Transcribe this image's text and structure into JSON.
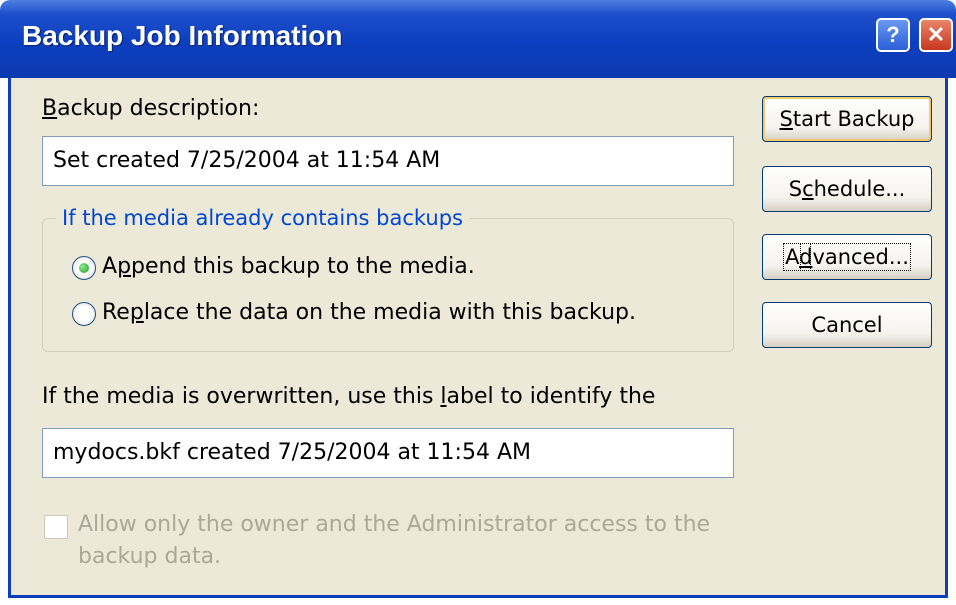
{
  "window": {
    "title": "Backup Job Information",
    "help_glyph": "?",
    "close_glyph": "✕"
  },
  "backup_description": {
    "label_pre": "",
    "label_key": "B",
    "label_post": "ackup description:",
    "value": "Set created 7/25/2004 at 11:54 AM"
  },
  "media_group": {
    "title": "If the media already contains backups",
    "append": {
      "pre": "A",
      "key": "p",
      "post": "pend this backup to the media.",
      "selected": true
    },
    "replace": {
      "pre": "Re",
      "key": "p",
      "post": "lace the data on the media with this backup.",
      "selected": false
    }
  },
  "label_section": {
    "pre": "If the media is overwritten, use this ",
    "key": "l",
    "post": "abel to identify the",
    "value": "mydocs.bkf created 7/25/2004 at 11:54 AM"
  },
  "owner_access": {
    "line1": "Allow only the owner and the Administrator access to the",
    "line2": "backup data.",
    "checked": false,
    "enabled": false
  },
  "buttons": {
    "start": {
      "key": "S",
      "post": "tart Backup"
    },
    "schedule": {
      "pre": "S",
      "key": "c",
      "post": "hedule..."
    },
    "advanced": {
      "pre": "A",
      "key": "d",
      "post": "vanced..."
    },
    "cancel": {
      "label": "Cancel"
    }
  },
  "colors": {
    "title_bar": "#0c3fbf",
    "dialog_face": "#ece9d8",
    "group_title": "#0046d5",
    "disabled_text": "#aca899"
  }
}
